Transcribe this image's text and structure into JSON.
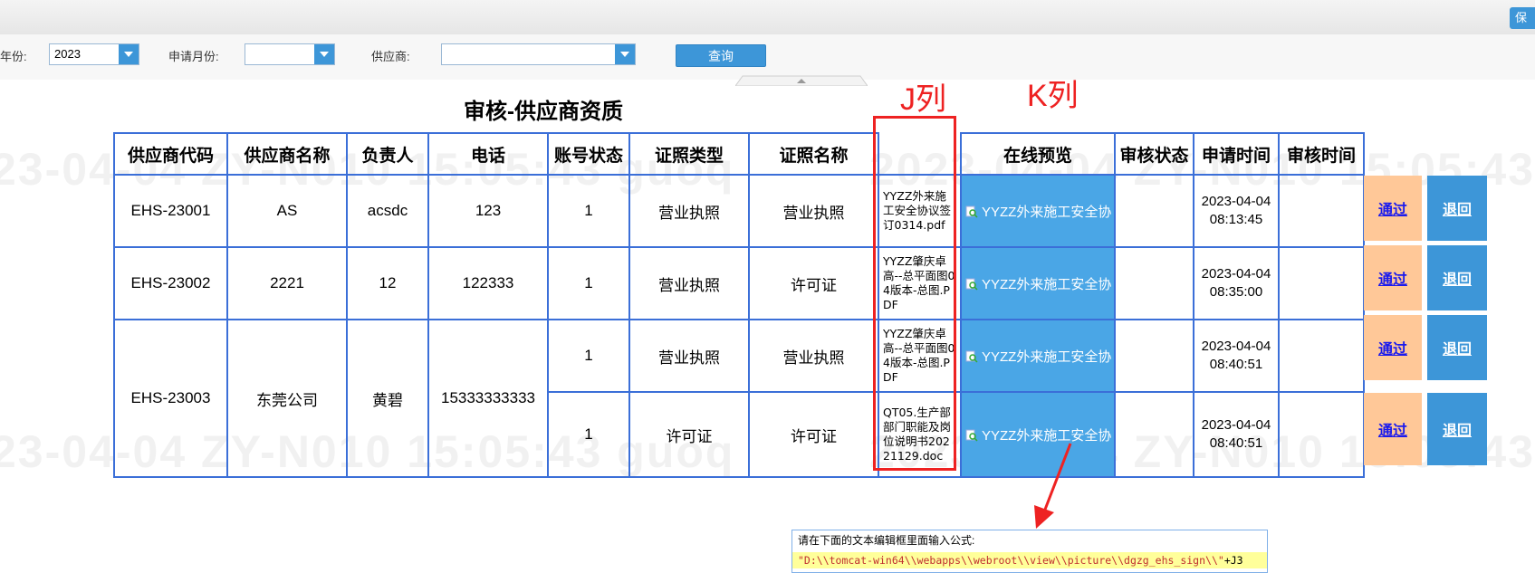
{
  "filters": {
    "year_label": "年份:",
    "year_value": "2023",
    "month_label": "申请月份:",
    "month_value": "",
    "supplier_label": "供应商:",
    "supplier_value": "",
    "query_button": "查询"
  },
  "topbar": {
    "right_button": "保"
  },
  "page_title": "审核-供应商资质",
  "annotations": {
    "j_label": "J列",
    "k_label": "K列"
  },
  "watermarks": {
    "row1": "23-04-04  ZY-N010  15:05:43  guoq",
    "row1b": "2023-04-04  ZY-N010  15:05:43  g",
    "row2": "23-04-04  ZY-N010  15:05:43  guoq",
    "row2b": "2023-04-04  ZY-N010  15:05:43"
  },
  "table": {
    "headers": [
      "供应商代码",
      "供应商名称",
      "负责人",
      "电话",
      "账号状态",
      "证照类型",
      "证照名称",
      "",
      "在线预览",
      "审核状态",
      "申请时间",
      "审核时间"
    ],
    "suppliers": [
      {
        "code": "EHS-23001",
        "name": "AS",
        "person": "acsdc",
        "phone": "123"
      },
      {
        "code": "EHS-23002",
        "name": "2221",
        "person": "12",
        "phone": "122333"
      },
      {
        "code": "EHS-23003",
        "name": "东莞公司",
        "person": "黄碧",
        "phone": "15333333333"
      }
    ],
    "rows": [
      {
        "status": "1",
        "type": "营业执照",
        "cert": "营业执照",
        "file": "YYZZ外来施工安全协议签订0314.pdf",
        "preview": "YYZZ外来施工安全协",
        "audit_status": "",
        "apply_time": "2023-04-04 08:13:45",
        "audit_time": ""
      },
      {
        "status": "1",
        "type": "营业执照",
        "cert": "许可证",
        "file": "YYZZ肇庆卓高--总平面图04版本-总图.PDF",
        "preview": "YYZZ外来施工安全协",
        "audit_status": "",
        "apply_time": "2023-04-04 08:35:00",
        "audit_time": ""
      },
      {
        "status": "1",
        "type": "营业执照",
        "cert": "营业执照",
        "file": "YYZZ肇庆卓高--总平面图04版本-总图.PDF",
        "preview": "YYZZ外来施工安全协",
        "audit_status": "",
        "apply_time": "2023-04-04 08:40:51",
        "audit_time": ""
      },
      {
        "status": "1",
        "type": "许可证",
        "cert": "许可证",
        "file": "QT05.生产部部门职能及岗位说明书20221129.doc",
        "preview": "YYZZ外来施工安全协",
        "audit_status": "",
        "apply_time": "2023-04-04 08:40:51",
        "audit_time": ""
      }
    ],
    "actions": {
      "pass": "通过",
      "back": "退回"
    }
  },
  "formula_box": {
    "hint": "请在下面的文本编辑框里面输入公式:",
    "code_str": "\"D:\\\\tomcat-win64\\\\webapps\\\\webroot\\\\view\\\\picture\\\\dgzg_ehs_sign\\\\\"",
    "code_tail": "+J3"
  },
  "colors": {
    "accent": "#3d96d8",
    "border": "#3b6fd8",
    "annotation": "#ee2222",
    "pass_bg": "#ffc898"
  }
}
